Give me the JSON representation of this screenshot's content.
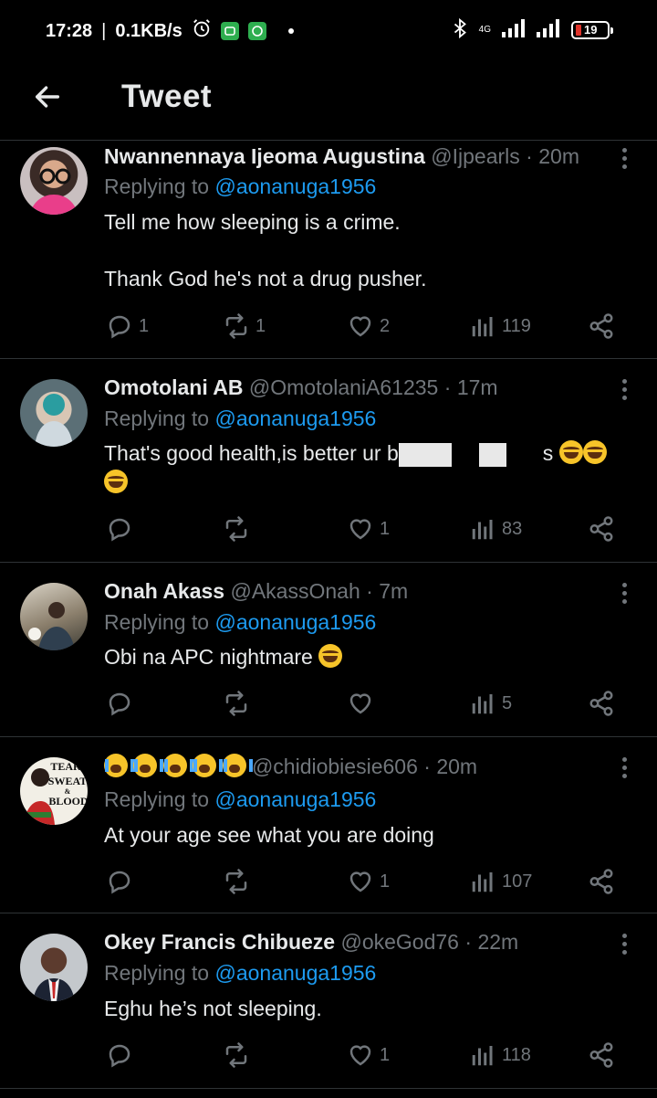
{
  "status_bar": {
    "time": "17:28",
    "network_speed": "0.1KB/s",
    "battery": "19",
    "signal_type": "4G",
    "icons": [
      "alarm-icon",
      "chat-app-icon",
      "whatsapp-icon",
      "bluetooth-icon",
      "signal-icon",
      "battery-icon"
    ]
  },
  "header": {
    "title": "Tweet",
    "back_icon": "arrow-left-icon"
  },
  "tweets": [
    {
      "name": "Nwannennaya Ijeoma Augustina",
      "handle": "@Ijpearls",
      "time": "20m",
      "replying_prefix": "Replying to ",
      "replying_to": "@aonanuga1956",
      "lines": [
        "Tell me how sleeping is a crime.",
        "Thank God he's not a drug pusher."
      ],
      "replies": "1",
      "retweets": "1",
      "likes": "2",
      "views": "119"
    },
    {
      "name": "Omotolani AB",
      "handle": "@OmotolaniA61235",
      "time": "17m",
      "replying_prefix": "Replying to ",
      "replying_to": "@aonanuga1956",
      "lines": [
        "That's good health,is better ur b",
        "s"
      ],
      "replies": "",
      "retweets": "",
      "likes": "1",
      "views": "83"
    },
    {
      "name": "Onah Akass",
      "handle": "@AkassOnah",
      "time": "7m",
      "replying_prefix": "Replying to ",
      "replying_to": "@aonanuga1956",
      "lines": [
        "Obi na APC nightmare"
      ],
      "replies": "",
      "retweets": "",
      "likes": "",
      "views": "5"
    },
    {
      "name": "",
      "handle": "@chidiobiesie606",
      "time": "20m",
      "replying_prefix": "Replying to ",
      "replying_to": "@aonanuga1956",
      "lines": [
        "At your age see what you are doing"
      ],
      "replies": "",
      "retweets": "",
      "likes": "1",
      "views": "107",
      "avatar_text": [
        "TEAR",
        "SWEAT",
        "&",
        "BLOOD"
      ]
    },
    {
      "name": "Okey Francis Chibueze",
      "handle": "@okeGod76",
      "time": "22m",
      "replying_prefix": "Replying to ",
      "replying_to": "@aonanuga1956",
      "lines": [
        "Eghu he’s not sleeping."
      ],
      "replies": "",
      "retweets": "",
      "likes": "1",
      "views": "118"
    }
  ],
  "separator": "·",
  "colors": {
    "background": "#000000",
    "text": "#e7e9ea",
    "muted": "#71767b",
    "link": "#1d9bf0",
    "divider": "#2f3336"
  }
}
